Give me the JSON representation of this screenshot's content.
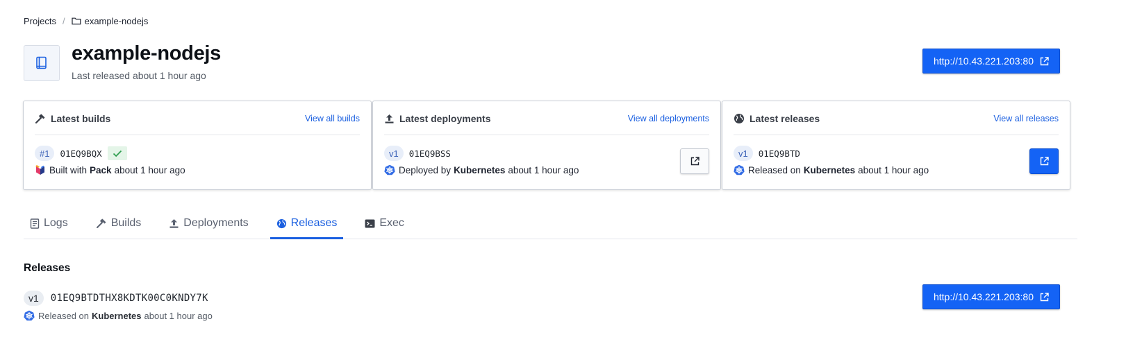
{
  "breadcrumb": {
    "root": "Projects",
    "separator": "/",
    "current": "example-nodejs",
    "folder_icon": "folder-icon"
  },
  "project": {
    "name": "example-nodejs",
    "subtitle": "Last released about 1 hour ago",
    "icon": "book-icon"
  },
  "header_url": {
    "label": "http://10.43.221.203:80",
    "icon": "external-link-icon"
  },
  "cards": {
    "builds": {
      "title": "Latest builds",
      "link": "View all builds",
      "tag": "#1",
      "id": "01EQ9BQX",
      "status_icon": "check-icon",
      "prefix": "Built with",
      "tool": "Pack",
      "time": "about 1 hour ago",
      "icon": "hammer-icon"
    },
    "deployments": {
      "title": "Latest deployments",
      "link": "View all deployments",
      "tag": "v1",
      "id": "01EQ9BSS",
      "prefix": "Deployed by",
      "platform": "Kubernetes",
      "time": "about 1 hour ago",
      "icon": "upload-icon"
    },
    "releases": {
      "title": "Latest releases",
      "link": "View all releases",
      "tag": "v1",
      "id": "01EQ9BTD",
      "prefix": "Released on",
      "platform": "Kubernetes",
      "time": "about 1 hour ago",
      "icon": "globe-icon"
    }
  },
  "tabs": [
    {
      "label": "Logs",
      "icon": "logs-icon"
    },
    {
      "label": "Builds",
      "icon": "hammer-icon"
    },
    {
      "label": "Deployments",
      "icon": "upload-icon"
    },
    {
      "label": "Releases",
      "icon": "globe-icon",
      "active": true
    },
    {
      "label": "Exec",
      "icon": "terminal-icon"
    }
  ],
  "releases_section": {
    "title": "Releases",
    "items": [
      {
        "tag": "v1",
        "id": "01EQ9BTDTHX8KDTK00C0KNDY7K",
        "prefix": "Released on",
        "platform": "Kubernetes",
        "time": "about 1 hour ago",
        "url": "http://10.43.221.203:80"
      }
    ]
  },
  "colors": {
    "primary": "#1463f5",
    "link": "#1a5fe0",
    "success_bg": "#e4f5e8",
    "success": "#2e9e4f",
    "kubernetes": "#326ce5"
  }
}
